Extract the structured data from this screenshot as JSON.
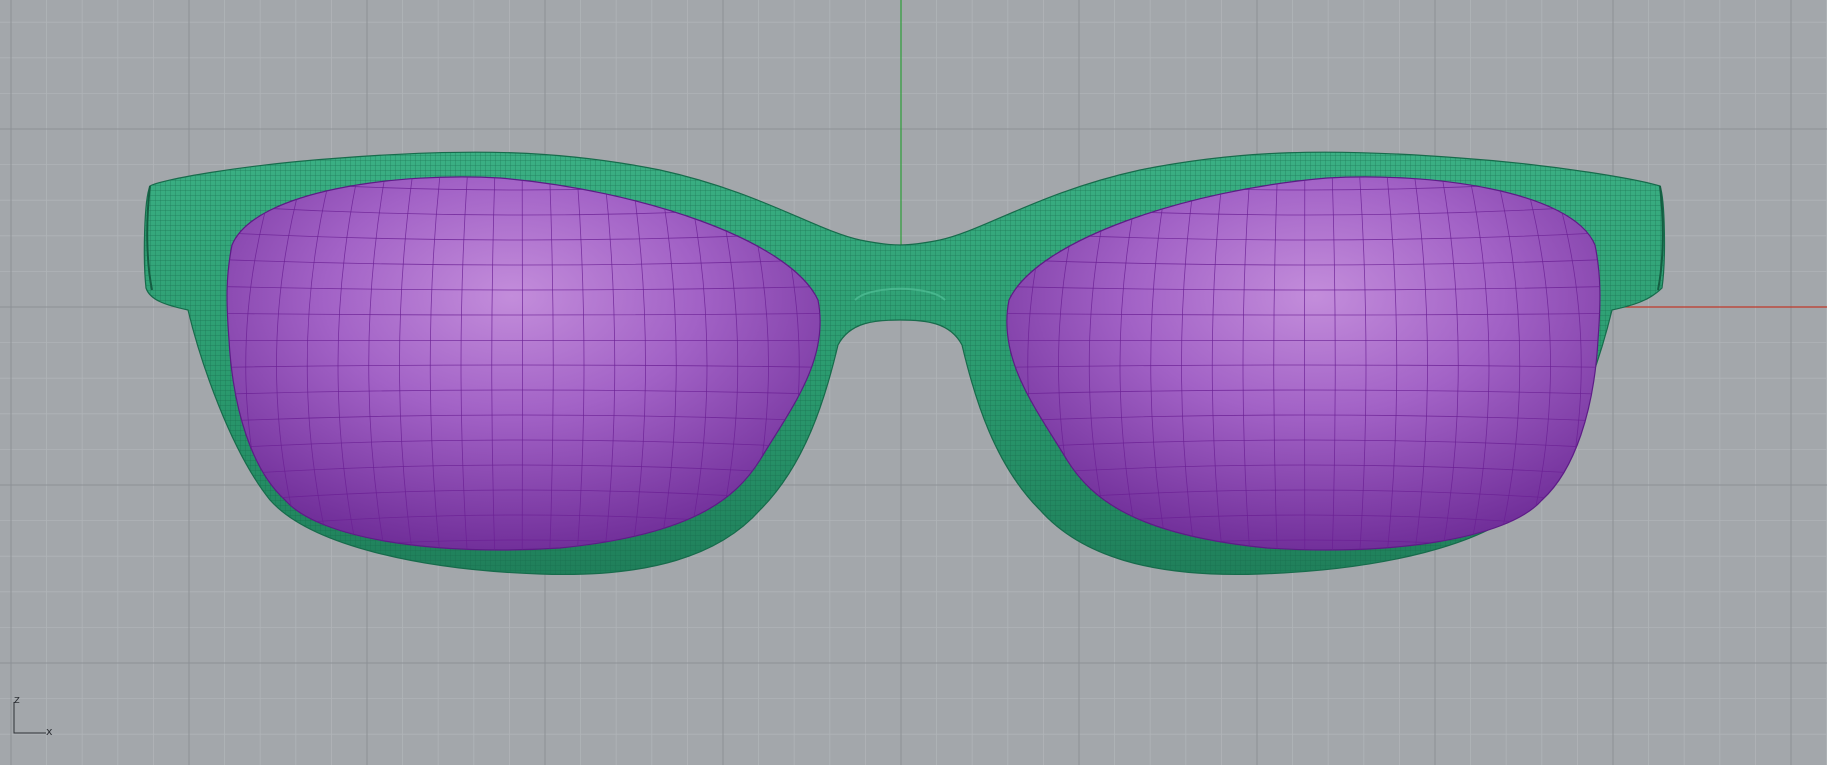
{
  "viewport": {
    "view": "front",
    "display_mode": "shaded-wireframe",
    "background_color": "#a3a7ab",
    "grid": true,
    "grid_minor_color": "#b0b4b8",
    "grid_major_color": "#8d9196",
    "axis_colors": {
      "x": "#c0392b",
      "z": "#2e9e3a"
    }
  },
  "axis_gizmo": {
    "vertical_label": "z",
    "horizontal_label": "x"
  },
  "model": {
    "object": "sunglasses",
    "frame_color": "#2b9a70",
    "frame_wire_color": "#17684a",
    "lens_color": "#a05bc4",
    "lens_wire_color": "#6a1f94"
  }
}
